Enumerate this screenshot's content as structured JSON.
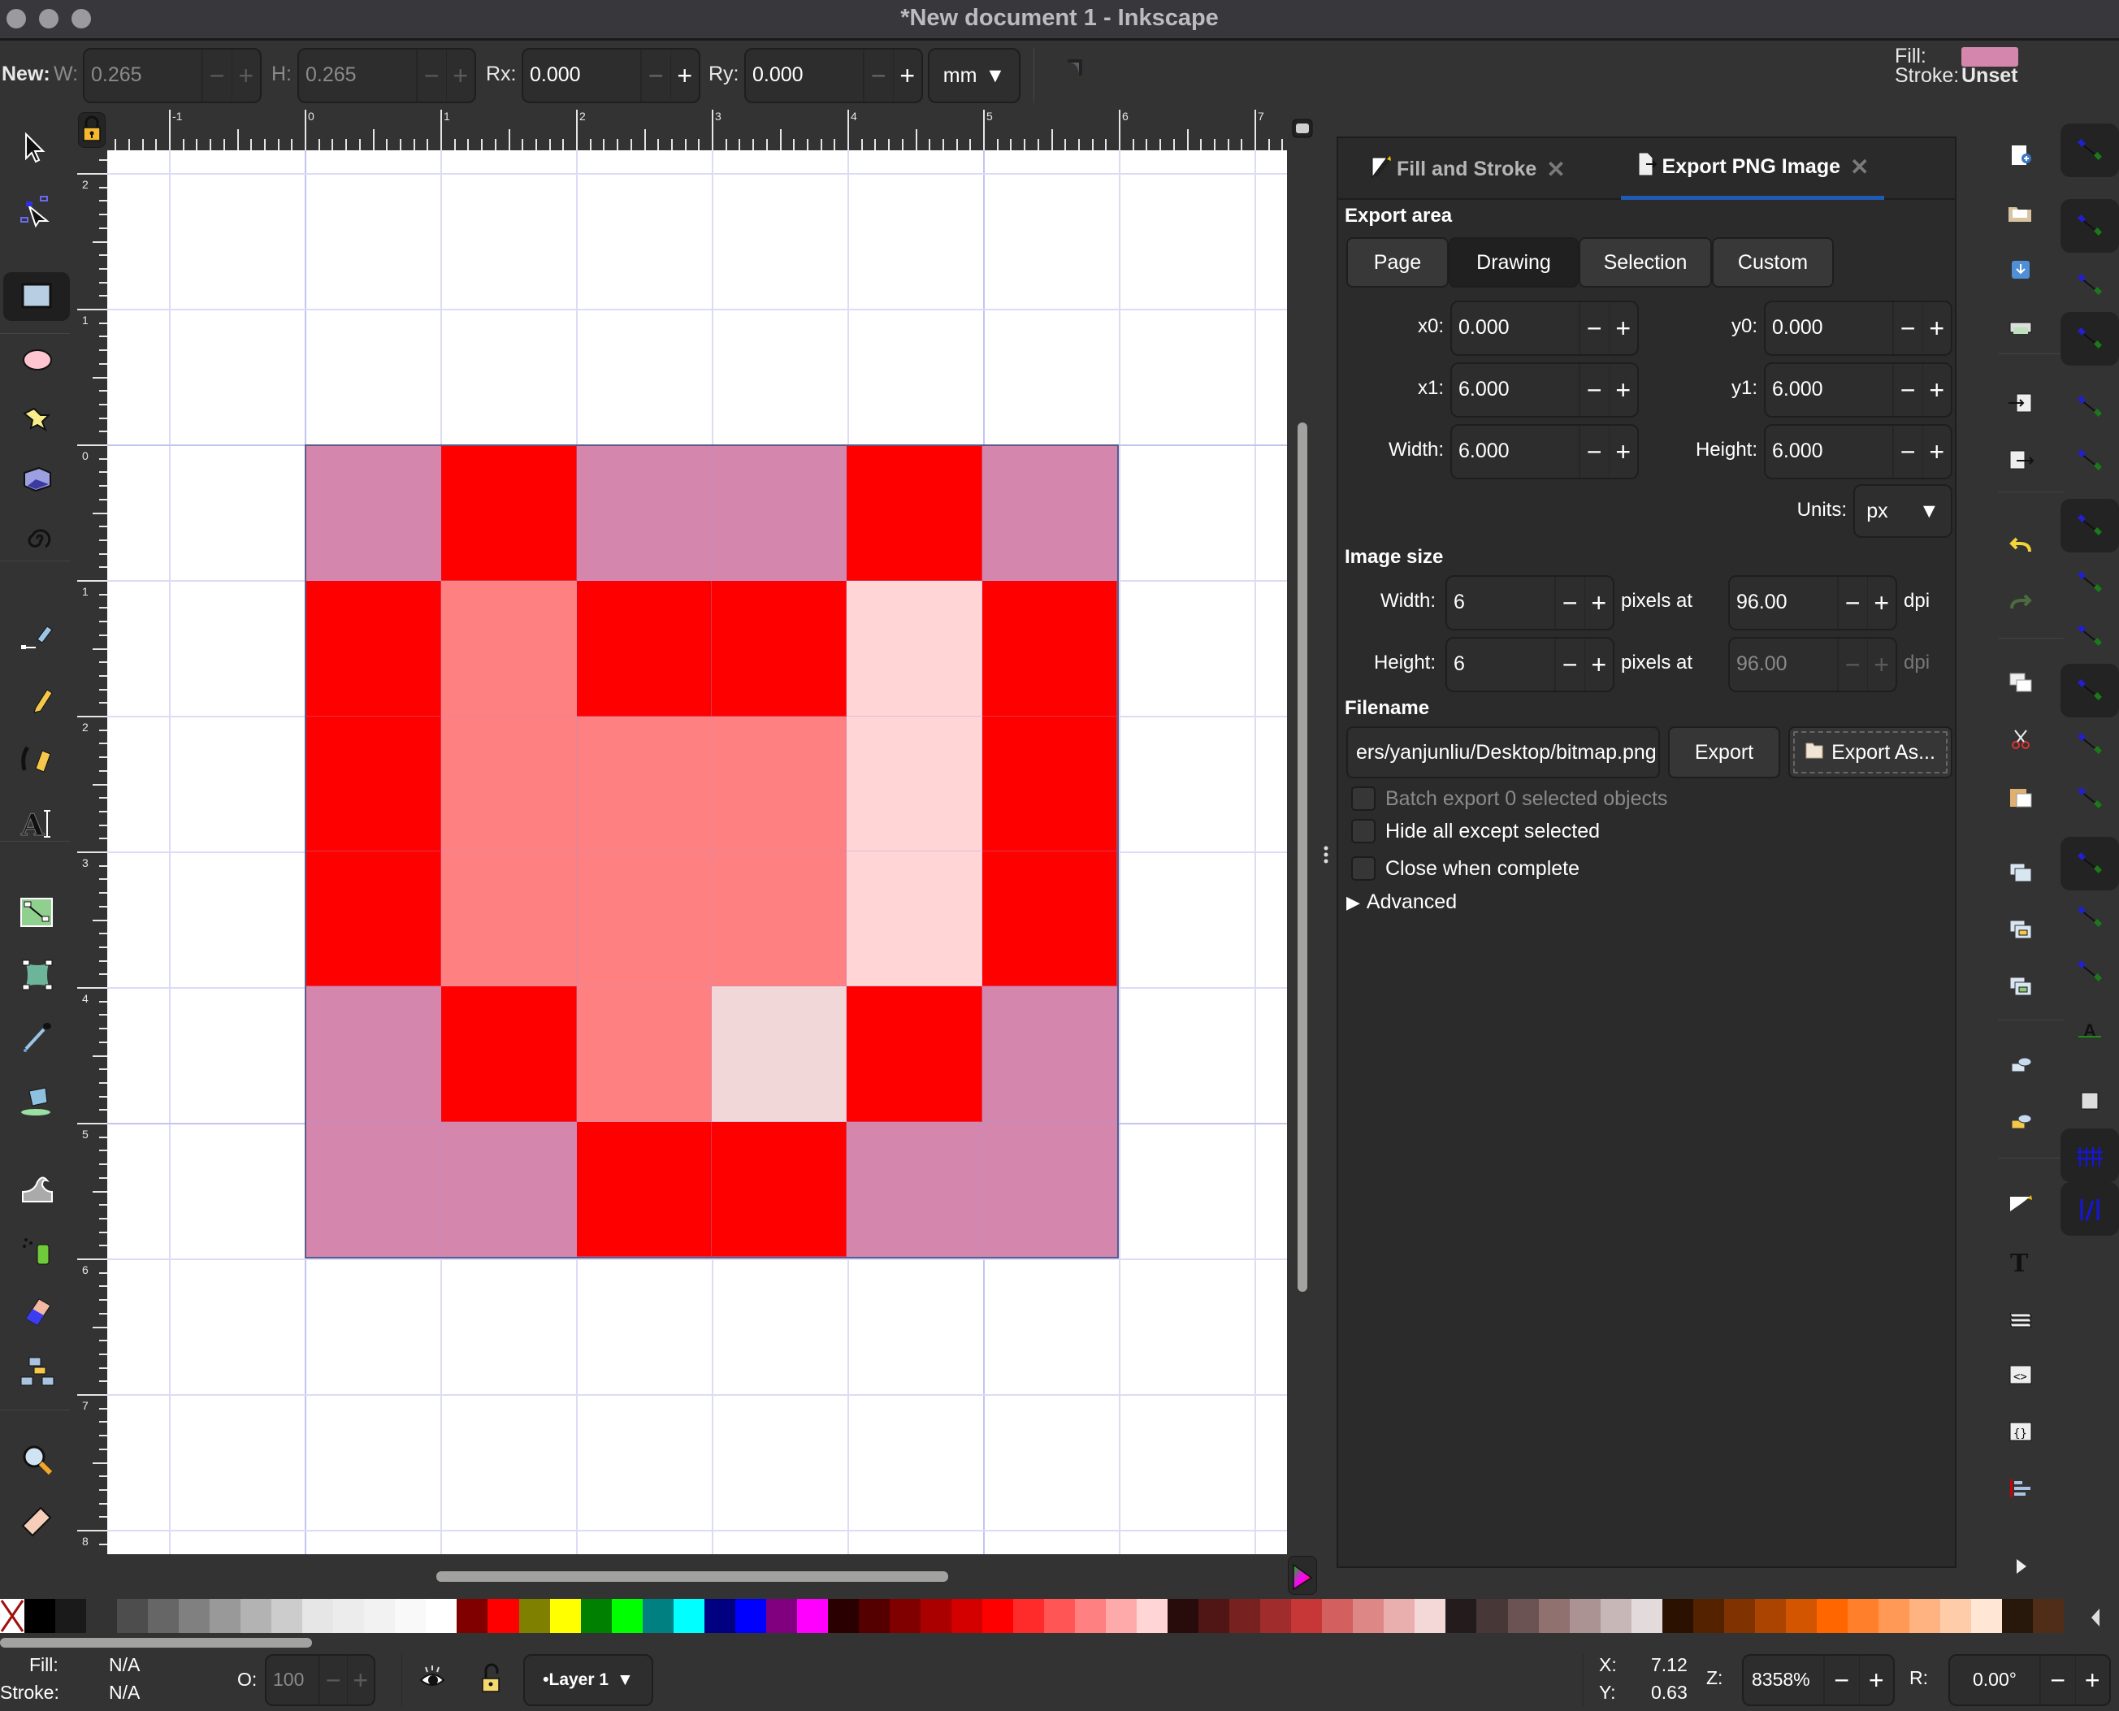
{
  "window": {
    "title": "*New document 1 - Inkscape"
  },
  "tool_controls": {
    "new_label": "New:",
    "w_label": "W:",
    "w_value": "0.265",
    "h_label": "H:",
    "h_value": "0.265",
    "rx_label": "Rx:",
    "rx_value": "0.000",
    "ry_label": "Ry:",
    "ry_value": "0.000",
    "units": "mm",
    "style_fill_label": "Fill:",
    "style_fill_color": "#d486ad",
    "style_stroke_label": "Stroke:",
    "style_stroke_value": "Unset"
  },
  "rulers": {
    "top_labels": [
      "-1",
      "0",
      "1",
      "2",
      "3",
      "4",
      "5",
      "6",
      "7"
    ],
    "left_labels": [
      "2",
      "1",
      "0",
      "1",
      "2",
      "3",
      "4",
      "5",
      "6",
      "7",
      "8"
    ]
  },
  "toolbox": {
    "tools": [
      {
        "name": "selector-tool",
        "label": "Selector"
      },
      {
        "name": "node-tool",
        "label": "Node"
      },
      {
        "name": "rectangle-tool",
        "label": "Rectangle",
        "active": true
      },
      {
        "name": "ellipse-tool",
        "label": "Ellipse"
      },
      {
        "name": "star-tool",
        "label": "Star/Polygon"
      },
      {
        "name": "3dbox-tool",
        "label": "3D Box"
      },
      {
        "name": "spiral-tool",
        "label": "Spiral"
      },
      {
        "name": "bezier-pen-tool",
        "label": "Pen"
      },
      {
        "name": "pencil-tool",
        "label": "Pencil"
      },
      {
        "name": "calligraphy-tool",
        "label": "Calligraphy"
      },
      {
        "name": "text-tool",
        "label": "Text"
      },
      {
        "name": "gradient-tool",
        "label": "Gradient"
      },
      {
        "name": "mesh-tool",
        "label": "Mesh"
      },
      {
        "name": "dropper-tool",
        "label": "Dropper"
      },
      {
        "name": "paint-bucket-tool",
        "label": "Paint Bucket"
      },
      {
        "name": "tweak-tool",
        "label": "Tweak"
      },
      {
        "name": "spray-tool",
        "label": "Spray"
      },
      {
        "name": "eraser-tool",
        "label": "Eraser"
      },
      {
        "name": "connector-tool",
        "label": "Connector"
      },
      {
        "name": "zoom-tool",
        "label": "Zoom"
      },
      {
        "name": "measure-tool",
        "label": "Measure"
      }
    ]
  },
  "canvas": {
    "pixel_grid": [
      [
        "#d486ad",
        "#ff0000",
        "#d486ad",
        "#d486ad",
        "#ff0000",
        "#d486ad"
      ],
      [
        "#ff0000",
        "#ff8080",
        "#ff0000",
        "#ff0000",
        "#ffd5d5",
        "#ff0000"
      ],
      [
        "#ff0000",
        "#ff8080",
        "#ff8080",
        "#ff8080",
        "#ffd5d5",
        "#ff0000"
      ],
      [
        "#ff0000",
        "#ff8080",
        "#ff8080",
        "#ff8080",
        "#ffd5d5",
        "#ff0000"
      ],
      [
        "#d486ad",
        "#ff0000",
        "#ff8080",
        "#f2d7d9",
        "#ff0000",
        "#d486ad"
      ],
      [
        "#d486ad",
        "#d486ad",
        "#ff0000",
        "#ff0000",
        "#d486ad",
        "#d486ad"
      ]
    ]
  },
  "dock": {
    "tabs": [
      {
        "label": "Fill and Stroke",
        "active": false
      },
      {
        "label": "Export PNG Image",
        "active": true
      }
    ],
    "export_area": {
      "heading": "Export area",
      "modes": [
        "Page",
        "Drawing",
        "Selection",
        "Custom"
      ],
      "active_mode": "Drawing",
      "x0_label": "x0:",
      "x0": "0.000",
      "y0_label": "y0:",
      "y0": "0.000",
      "x1_label": "x1:",
      "x1": "6.000",
      "y1_label": "y1:",
      "y1": "6.000",
      "width_label": "Width:",
      "width": "6.000",
      "height_label": "Height:",
      "height": "6.000",
      "units_label": "Units:",
      "units": "px"
    },
    "image_size": {
      "heading": "Image size",
      "width_label": "Width:",
      "width": "6",
      "height_label": "Height:",
      "height": "6",
      "pixels_at": "pixels at",
      "dpi_x": "96.00",
      "dpi_y": "96.00",
      "dpi_unit": "dpi"
    },
    "filename": {
      "heading": "Filename",
      "value": "ers/yanjunliu/Desktop/bitmap.png",
      "export_label": "Export",
      "export_as_label": "Export As..."
    },
    "options": {
      "batch_export": "Batch export 0 selected objects",
      "hide_all": "Hide all except selected",
      "close_when_complete": "Close when complete",
      "advanced": "Advanced"
    }
  },
  "commands": [
    "new-document",
    "open",
    "save",
    "print",
    "import",
    "export",
    "undo",
    "redo",
    "copy",
    "cut",
    "paste",
    "duplicate",
    "clone",
    "unlink-clone",
    "group",
    "ungroup",
    "fill-stroke",
    "text-font",
    "layers",
    "xml-editor",
    "selectors-css",
    "align-distribute"
  ],
  "palette": {
    "colors": [
      "#000000",
      "#1a1a1a",
      "#333333",
      "#4d4d4d",
      "#666666",
      "#808080",
      "#999999",
      "#b3b3b3",
      "#cccccc",
      "#e6e6e6",
      "#ececec",
      "#f2f2f2",
      "#f9f9f9",
      "#ffffff",
      "#800000",
      "#ff0000",
      "#808000",
      "#ffff00",
      "#008000",
      "#00ff00",
      "#008080",
      "#00ffff",
      "#000080",
      "#0000ff",
      "#800080",
      "#ff00ff",
      "#2b0000",
      "#550000",
      "#800000",
      "#aa0000",
      "#d40000",
      "#ff0000",
      "#ff2a2a",
      "#ff5555",
      "#ff8080",
      "#ffaaaa",
      "#ffd5d5",
      "#280b0b",
      "#501616",
      "#782121",
      "#a02c2c",
      "#c83737",
      "#d35f5f",
      "#de8787",
      "#e9afaf",
      "#f4d7d7",
      "#241c1c",
      "#483737",
      "#6c5353",
      "#917070",
      "#ac9393",
      "#c8b7b7",
      "#e3dbdb",
      "#2b1100",
      "#552200",
      "#803300",
      "#aa4400",
      "#d45500",
      "#ff6600",
      "#ff7f2a",
      "#ff9955",
      "#ffb380",
      "#ffccaa",
      "#ffe6d5",
      "#28170b",
      "#502d16"
    ]
  },
  "status": {
    "fill_label": "Fill:",
    "fill_value": "N/A",
    "stroke_label": "Stroke:",
    "stroke_value": "N/A",
    "opacity_label": "O:",
    "opacity_value": "100",
    "layer": "•Layer 1",
    "x_label": "X:",
    "x_value": "7.12",
    "y_label": "Y:",
    "y_value": "0.63",
    "zoom_label": "Z:",
    "zoom_value": "8358%",
    "rotate_label": "R:",
    "rotate_value": "0.00°"
  }
}
